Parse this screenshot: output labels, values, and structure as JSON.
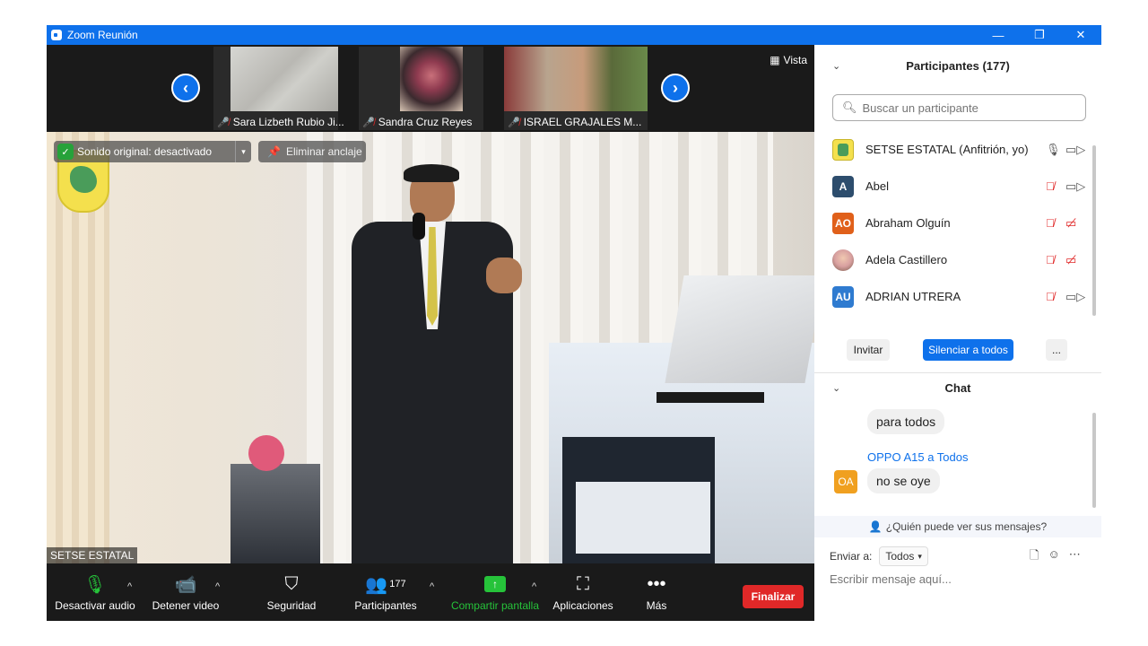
{
  "window": {
    "title": "Zoom Reunión",
    "min": "—",
    "restore": "❐",
    "close": "✕"
  },
  "strip": {
    "thumbs": [
      {
        "name": "Sara Lizbeth Rubio Ji..."
      },
      {
        "name": "Sandra Cruz Reyes"
      },
      {
        "name": "ISRAEL GRAJALES M..."
      }
    ],
    "prev": "‹",
    "next": "›",
    "vista_label": "Vista"
  },
  "main": {
    "original_sound": "Sonido original: desactivado",
    "unpin": "Eliminar anclaje",
    "speaker_name": "SETSE ESTATAL"
  },
  "toolbar": {
    "audio": "Desactivar audio",
    "video": "Detener video",
    "security": "Seguridad",
    "participants": "Participantes",
    "participants_count": "177",
    "share": "Compartir pantalla",
    "apps": "Aplicaciones",
    "more": "Más",
    "end": "Finalizar"
  },
  "participants_panel": {
    "title": "Participantes (177)",
    "search_placeholder": "Buscar un participante",
    "list": [
      {
        "initials": "",
        "name": "SETSE ESTATAL (Anfitrión, yo)",
        "color": "#f4e04d",
        "mic": "on",
        "cam": "off"
      },
      {
        "initials": "A",
        "name": "Abel",
        "color": "#2d4d6d",
        "mic": "muted",
        "cam": "off"
      },
      {
        "initials": "AO",
        "name": "Abraham Olguín",
        "color": "#e0601a",
        "mic": "muted",
        "cam": "blocked"
      },
      {
        "initials": "",
        "name": "Adela Castillero",
        "color": "#d8a0a0",
        "mic": "muted",
        "cam": "blocked"
      },
      {
        "initials": "AU",
        "name": "ADRIAN UTRERA",
        "color": "#2f7bd0",
        "mic": "muted",
        "cam": "off"
      }
    ],
    "invite": "Invitar",
    "mute_all": "Silenciar a todos",
    "more": "..."
  },
  "chat": {
    "title": "Chat",
    "messages": [
      {
        "sender": "",
        "text": "para todos"
      },
      {
        "sender": "OPPO A15 a Todos",
        "initials": "OA",
        "text": "no se oye"
      }
    ],
    "who_can_see": "¿Quién puede ver sus mensajes?",
    "send_to_label": "Enviar a:",
    "send_to_value": "Todos",
    "input_placeholder": "Escribir mensaje aquí..."
  },
  "colors": {
    "brand": "#0e71eb",
    "end": "#e02828",
    "share": "#26c33a"
  }
}
